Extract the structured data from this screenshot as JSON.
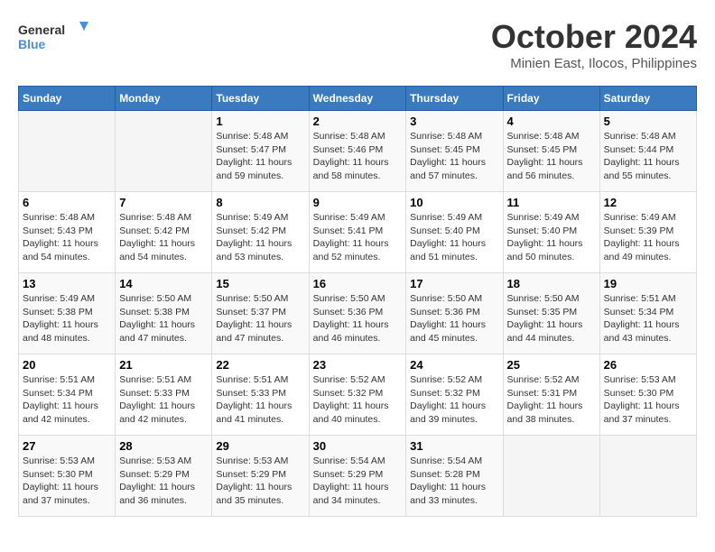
{
  "logo": {
    "text_line1": "General",
    "text_line2": "Blue"
  },
  "header": {
    "month": "October 2024",
    "location": "Minien East, Ilocos, Philippines"
  },
  "weekdays": [
    "Sunday",
    "Monday",
    "Tuesday",
    "Wednesday",
    "Thursday",
    "Friday",
    "Saturday"
  ],
  "weeks": [
    [
      {
        "day": "",
        "info": ""
      },
      {
        "day": "",
        "info": ""
      },
      {
        "day": "1",
        "info": "Sunrise: 5:48 AM\nSunset: 5:47 PM\nDaylight: 11 hours and 59 minutes."
      },
      {
        "day": "2",
        "info": "Sunrise: 5:48 AM\nSunset: 5:46 PM\nDaylight: 11 hours and 58 minutes."
      },
      {
        "day": "3",
        "info": "Sunrise: 5:48 AM\nSunset: 5:45 PM\nDaylight: 11 hours and 57 minutes."
      },
      {
        "day": "4",
        "info": "Sunrise: 5:48 AM\nSunset: 5:45 PM\nDaylight: 11 hours and 56 minutes."
      },
      {
        "day": "5",
        "info": "Sunrise: 5:48 AM\nSunset: 5:44 PM\nDaylight: 11 hours and 55 minutes."
      }
    ],
    [
      {
        "day": "6",
        "info": "Sunrise: 5:48 AM\nSunset: 5:43 PM\nDaylight: 11 hours and 54 minutes."
      },
      {
        "day": "7",
        "info": "Sunrise: 5:48 AM\nSunset: 5:42 PM\nDaylight: 11 hours and 54 minutes."
      },
      {
        "day": "8",
        "info": "Sunrise: 5:49 AM\nSunset: 5:42 PM\nDaylight: 11 hours and 53 minutes."
      },
      {
        "day": "9",
        "info": "Sunrise: 5:49 AM\nSunset: 5:41 PM\nDaylight: 11 hours and 52 minutes."
      },
      {
        "day": "10",
        "info": "Sunrise: 5:49 AM\nSunset: 5:40 PM\nDaylight: 11 hours and 51 minutes."
      },
      {
        "day": "11",
        "info": "Sunrise: 5:49 AM\nSunset: 5:40 PM\nDaylight: 11 hours and 50 minutes."
      },
      {
        "day": "12",
        "info": "Sunrise: 5:49 AM\nSunset: 5:39 PM\nDaylight: 11 hours and 49 minutes."
      }
    ],
    [
      {
        "day": "13",
        "info": "Sunrise: 5:49 AM\nSunset: 5:38 PM\nDaylight: 11 hours and 48 minutes."
      },
      {
        "day": "14",
        "info": "Sunrise: 5:50 AM\nSunset: 5:38 PM\nDaylight: 11 hours and 47 minutes."
      },
      {
        "day": "15",
        "info": "Sunrise: 5:50 AM\nSunset: 5:37 PM\nDaylight: 11 hours and 47 minutes."
      },
      {
        "day": "16",
        "info": "Sunrise: 5:50 AM\nSunset: 5:36 PM\nDaylight: 11 hours and 46 minutes."
      },
      {
        "day": "17",
        "info": "Sunrise: 5:50 AM\nSunset: 5:36 PM\nDaylight: 11 hours and 45 minutes."
      },
      {
        "day": "18",
        "info": "Sunrise: 5:50 AM\nSunset: 5:35 PM\nDaylight: 11 hours and 44 minutes."
      },
      {
        "day": "19",
        "info": "Sunrise: 5:51 AM\nSunset: 5:34 PM\nDaylight: 11 hours and 43 minutes."
      }
    ],
    [
      {
        "day": "20",
        "info": "Sunrise: 5:51 AM\nSunset: 5:34 PM\nDaylight: 11 hours and 42 minutes."
      },
      {
        "day": "21",
        "info": "Sunrise: 5:51 AM\nSunset: 5:33 PM\nDaylight: 11 hours and 42 minutes."
      },
      {
        "day": "22",
        "info": "Sunrise: 5:51 AM\nSunset: 5:33 PM\nDaylight: 11 hours and 41 minutes."
      },
      {
        "day": "23",
        "info": "Sunrise: 5:52 AM\nSunset: 5:32 PM\nDaylight: 11 hours and 40 minutes."
      },
      {
        "day": "24",
        "info": "Sunrise: 5:52 AM\nSunset: 5:32 PM\nDaylight: 11 hours and 39 minutes."
      },
      {
        "day": "25",
        "info": "Sunrise: 5:52 AM\nSunset: 5:31 PM\nDaylight: 11 hours and 38 minutes."
      },
      {
        "day": "26",
        "info": "Sunrise: 5:53 AM\nSunset: 5:30 PM\nDaylight: 11 hours and 37 minutes."
      }
    ],
    [
      {
        "day": "27",
        "info": "Sunrise: 5:53 AM\nSunset: 5:30 PM\nDaylight: 11 hours and 37 minutes."
      },
      {
        "day": "28",
        "info": "Sunrise: 5:53 AM\nSunset: 5:29 PM\nDaylight: 11 hours and 36 minutes."
      },
      {
        "day": "29",
        "info": "Sunrise: 5:53 AM\nSunset: 5:29 PM\nDaylight: 11 hours and 35 minutes."
      },
      {
        "day": "30",
        "info": "Sunrise: 5:54 AM\nSunset: 5:29 PM\nDaylight: 11 hours and 34 minutes."
      },
      {
        "day": "31",
        "info": "Sunrise: 5:54 AM\nSunset: 5:28 PM\nDaylight: 11 hours and 33 minutes."
      },
      {
        "day": "",
        "info": ""
      },
      {
        "day": "",
        "info": ""
      }
    ]
  ]
}
